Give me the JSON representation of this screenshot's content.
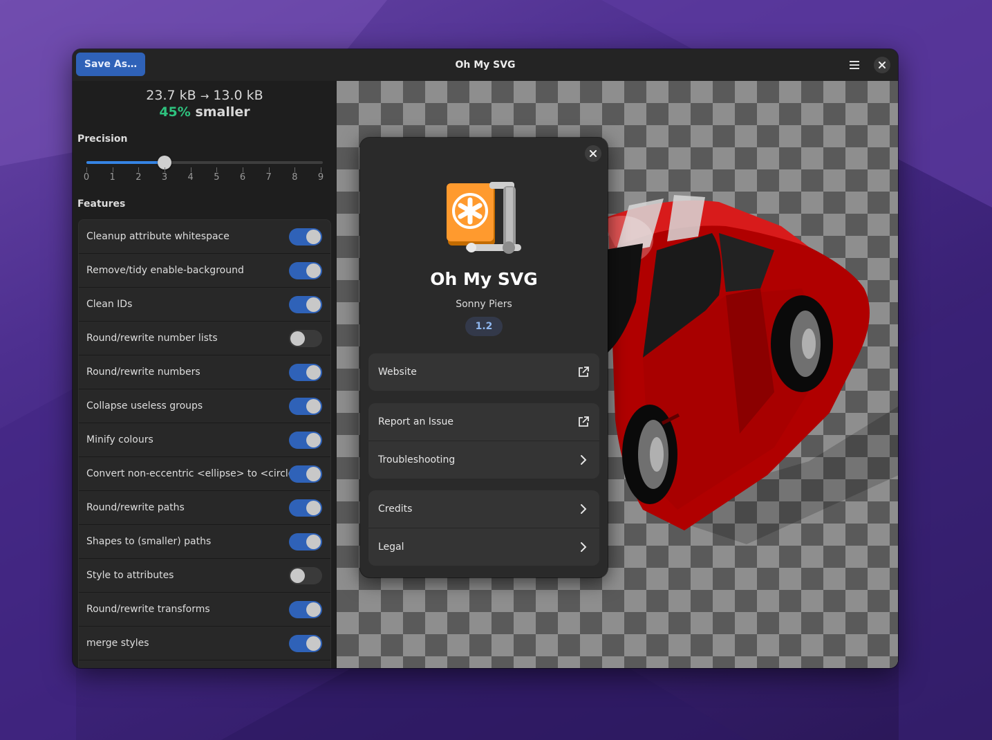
{
  "window": {
    "title": "Oh My SVG",
    "save_label": "Save As…",
    "menu_icon": "hamburger-menu-icon",
    "close_icon": "close-icon"
  },
  "stats": {
    "original_size": "23.7 kB",
    "arrow": "→",
    "optimized_size": "13.0 kB",
    "percent": "45%",
    "percent_suffix": "smaller"
  },
  "precision": {
    "label": "Precision",
    "value": 3,
    "min": 0,
    "max": 9,
    "ticks": [
      "0",
      "1",
      "2",
      "3",
      "4",
      "5",
      "6",
      "7",
      "8",
      "9"
    ]
  },
  "features": {
    "label": "Features",
    "items": [
      {
        "label": "Cleanup attribute whitespace",
        "enabled": true
      },
      {
        "label": "Remove/tidy enable-background",
        "enabled": true
      },
      {
        "label": "Clean IDs",
        "enabled": true
      },
      {
        "label": "Round/rewrite number lists",
        "enabled": false
      },
      {
        "label": "Round/rewrite numbers",
        "enabled": true
      },
      {
        "label": "Collapse useless groups",
        "enabled": true
      },
      {
        "label": "Minify colours",
        "enabled": true
      },
      {
        "label": "Convert non-eccentric <ellipse> to <circle>",
        "enabled": true
      },
      {
        "label": "Round/rewrite paths",
        "enabled": true
      },
      {
        "label": "Shapes to (smaller) paths",
        "enabled": true
      },
      {
        "label": "Style to attributes",
        "enabled": false
      },
      {
        "label": "Round/rewrite transforms",
        "enabled": true
      },
      {
        "label": "merge styles",
        "enabled": true
      },
      {
        "label": "",
        "enabled": true
      }
    ]
  },
  "about": {
    "app_name": "Oh My SVG",
    "developer": "Sonny Piers",
    "version": "1.2",
    "close_icon": "close-icon",
    "app_icon": "oh-my-svg-app-icon",
    "groups": [
      [
        {
          "label": "Website",
          "icon": "external-link-icon"
        }
      ],
      [
        {
          "label": "Report an Issue",
          "icon": "external-link-icon"
        },
        {
          "label": "Troubleshooting",
          "icon": "chevron-right-icon"
        }
      ],
      [
        {
          "label": "Credits",
          "icon": "chevron-right-icon"
        },
        {
          "label": "Legal",
          "icon": "chevron-right-icon"
        }
      ]
    ]
  },
  "colors": {
    "accent": "#2f62b8",
    "success": "#2ec27e",
    "window_bg": "#1e1e1e",
    "car_red": "#c00000"
  }
}
